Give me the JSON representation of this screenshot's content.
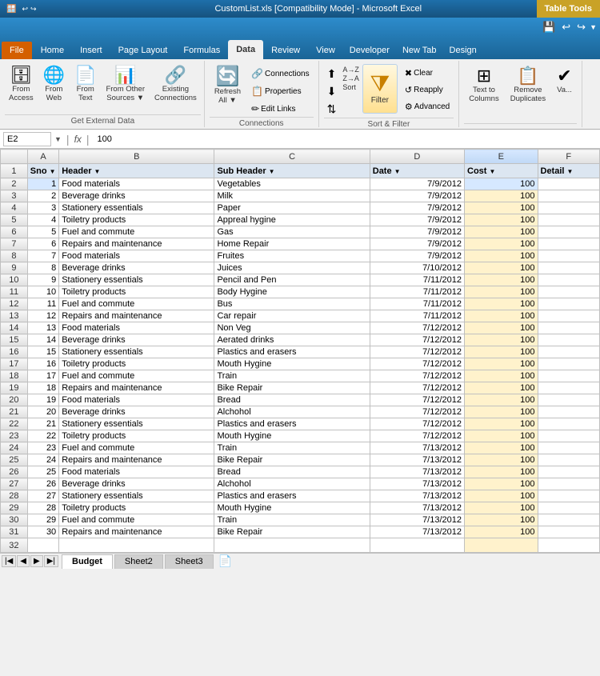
{
  "titleBar": {
    "title": "CustomList.xls [Compatibility Mode] - Microsoft Excel",
    "tableToolsBadge": "Table Tools"
  },
  "ribbonTabs": [
    {
      "label": "File",
      "id": "file"
    },
    {
      "label": "Home",
      "id": "home"
    },
    {
      "label": "Insert",
      "id": "insert"
    },
    {
      "label": "Page Layout",
      "id": "page-layout"
    },
    {
      "label": "Formulas",
      "id": "formulas"
    },
    {
      "label": "Data",
      "id": "data",
      "active": true
    },
    {
      "label": "Review",
      "id": "review"
    },
    {
      "label": "View",
      "id": "view"
    },
    {
      "label": "Developer",
      "id": "developer"
    },
    {
      "label": "New Tab",
      "id": "new-tab"
    },
    {
      "label": "Design",
      "id": "design"
    }
  ],
  "ribbonGroups": {
    "getExternalData": {
      "label": "Get External Data",
      "buttons": [
        {
          "id": "from-access",
          "label": "From\nAccess",
          "icon": "🗄"
        },
        {
          "id": "from-web",
          "label": "From\nWeb",
          "icon": "🌐"
        },
        {
          "id": "from-text",
          "label": "From\nText",
          "icon": "📄"
        },
        {
          "id": "from-other-sources",
          "label": "From Other\nSources",
          "icon": "📊"
        },
        {
          "id": "existing-connections",
          "label": "Existing\nConnections",
          "icon": "🔗"
        }
      ]
    },
    "connections": {
      "label": "Connections",
      "buttons": [
        {
          "id": "refresh-all",
          "label": "Refresh\nAll ▼",
          "icon": "🔄"
        },
        {
          "id": "connections",
          "label": "Connections",
          "icon": "🔗"
        },
        {
          "id": "properties",
          "label": "Properties",
          "icon": "📋"
        },
        {
          "id": "edit-links",
          "label": "Edit Links",
          "icon": "🔗"
        }
      ]
    },
    "sortFilter": {
      "label": "Sort & Filter",
      "sortButtons": [
        {
          "id": "sort-az",
          "icon": "↑",
          "label": "A→Z"
        },
        {
          "id": "sort-za",
          "icon": "↓",
          "label": "Z→A"
        },
        {
          "id": "sort-dialog",
          "icon": "⇅",
          "label": "Sort"
        }
      ],
      "filterButtons": [
        {
          "id": "filter",
          "label": "Filter",
          "icon": "▼"
        },
        {
          "id": "clear",
          "label": "Clear"
        },
        {
          "id": "reapply",
          "label": "Reapply"
        },
        {
          "id": "advanced",
          "label": "Advanced"
        }
      ]
    },
    "dataTools": {
      "label": "",
      "buttons": [
        {
          "id": "text-to-columns",
          "label": "Text to\nColumns",
          "icon": "⊞"
        },
        {
          "id": "remove-duplicates",
          "label": "Remove\nDuplicates",
          "icon": "⊠"
        }
      ]
    }
  },
  "formulaBar": {
    "nameBox": "E2",
    "formula": "100"
  },
  "headers": [
    "Sno",
    "Header",
    "Sub Header",
    "Date",
    "Cost",
    "Detail"
  ],
  "columnWidths": [
    "28px",
    "140px",
    "140px",
    "85px",
    "65px",
    "55px"
  ],
  "rows": [
    {
      "sno": 1,
      "header": "Food materials",
      "subHeader": "Vegetables",
      "date": "7/9/2012",
      "cost": 100,
      "detail": ""
    },
    {
      "sno": 2,
      "header": "Beverage drinks",
      "subHeader": "Milk",
      "date": "7/9/2012",
      "cost": 100,
      "detail": ""
    },
    {
      "sno": 3,
      "header": "Stationery essentials",
      "subHeader": "Paper",
      "date": "7/9/2012",
      "cost": 100,
      "detail": ""
    },
    {
      "sno": 4,
      "header": "Toiletry products",
      "subHeader": "Appreal hygine",
      "date": "7/9/2012",
      "cost": 100,
      "detail": ""
    },
    {
      "sno": 5,
      "header": "Fuel and commute",
      "subHeader": "Gas",
      "date": "7/9/2012",
      "cost": 100,
      "detail": ""
    },
    {
      "sno": 6,
      "header": "Repairs and maintenance",
      "subHeader": "Home Repair",
      "date": "7/9/2012",
      "cost": 100,
      "detail": ""
    },
    {
      "sno": 7,
      "header": "Food materials",
      "subHeader": "Fruites",
      "date": "7/9/2012",
      "cost": 100,
      "detail": ""
    },
    {
      "sno": 8,
      "header": "Beverage drinks",
      "subHeader": "Juices",
      "date": "7/10/2012",
      "cost": 100,
      "detail": ""
    },
    {
      "sno": 9,
      "header": "Stationery essentials",
      "subHeader": "Pencil and Pen",
      "date": "7/11/2012",
      "cost": 100,
      "detail": ""
    },
    {
      "sno": 10,
      "header": "Toiletry products",
      "subHeader": "Body Hygine",
      "date": "7/11/2012",
      "cost": 100,
      "detail": ""
    },
    {
      "sno": 11,
      "header": "Fuel and commute",
      "subHeader": "Bus",
      "date": "7/11/2012",
      "cost": 100,
      "detail": ""
    },
    {
      "sno": 12,
      "header": "Repairs and maintenance",
      "subHeader": "Car repair",
      "date": "7/11/2012",
      "cost": 100,
      "detail": ""
    },
    {
      "sno": 13,
      "header": "Food materials",
      "subHeader": "Non Veg",
      "date": "7/12/2012",
      "cost": 100,
      "detail": ""
    },
    {
      "sno": 14,
      "header": "Beverage drinks",
      "subHeader": "Aerated drinks",
      "date": "7/12/2012",
      "cost": 100,
      "detail": ""
    },
    {
      "sno": 15,
      "header": "Stationery essentials",
      "subHeader": "Plastics and erasers",
      "date": "7/12/2012",
      "cost": 100,
      "detail": ""
    },
    {
      "sno": 16,
      "header": "Toiletry products",
      "subHeader": "Mouth Hygine",
      "date": "7/12/2012",
      "cost": 100,
      "detail": ""
    },
    {
      "sno": 17,
      "header": "Fuel and commute",
      "subHeader": "Train",
      "date": "7/12/2012",
      "cost": 100,
      "detail": ""
    },
    {
      "sno": 18,
      "header": "Repairs and maintenance",
      "subHeader": "Bike Repair",
      "date": "7/12/2012",
      "cost": 100,
      "detail": ""
    },
    {
      "sno": 19,
      "header": "Food materials",
      "subHeader": "Bread",
      "date": "7/12/2012",
      "cost": 100,
      "detail": ""
    },
    {
      "sno": 20,
      "header": "Beverage drinks",
      "subHeader": "Alchohol",
      "date": "7/12/2012",
      "cost": 100,
      "detail": ""
    },
    {
      "sno": 21,
      "header": "Stationery essentials",
      "subHeader": "Plastics and erasers",
      "date": "7/12/2012",
      "cost": 100,
      "detail": ""
    },
    {
      "sno": 22,
      "header": "Toiletry products",
      "subHeader": "Mouth Hygine",
      "date": "7/12/2012",
      "cost": 100,
      "detail": ""
    },
    {
      "sno": 23,
      "header": "Fuel and commute",
      "subHeader": "Train",
      "date": "7/13/2012",
      "cost": 100,
      "detail": ""
    },
    {
      "sno": 24,
      "header": "Repairs and maintenance",
      "subHeader": "Bike Repair",
      "date": "7/13/2012",
      "cost": 100,
      "detail": ""
    },
    {
      "sno": 25,
      "header": "Food materials",
      "subHeader": "Bread",
      "date": "7/13/2012",
      "cost": 100,
      "detail": ""
    },
    {
      "sno": 26,
      "header": "Beverage drinks",
      "subHeader": "Alchohol",
      "date": "7/13/2012",
      "cost": 100,
      "detail": ""
    },
    {
      "sno": 27,
      "header": "Stationery essentials",
      "subHeader": "Plastics and erasers",
      "date": "7/13/2012",
      "cost": 100,
      "detail": ""
    },
    {
      "sno": 28,
      "header": "Toiletry products",
      "subHeader": "Mouth Hygine",
      "date": "7/13/2012",
      "cost": 100,
      "detail": ""
    },
    {
      "sno": 29,
      "header": "Fuel and commute",
      "subHeader": "Train",
      "date": "7/13/2012",
      "cost": 100,
      "detail": ""
    },
    {
      "sno": 30,
      "header": "Repairs and maintenance",
      "subHeader": "Bike Repair",
      "date": "7/13/2012",
      "cost": 100,
      "detail": ""
    }
  ],
  "emptyRow": 32,
  "sheets": [
    "Budget",
    "Sheet2",
    "Sheet3"
  ],
  "activeSheet": "Budget"
}
